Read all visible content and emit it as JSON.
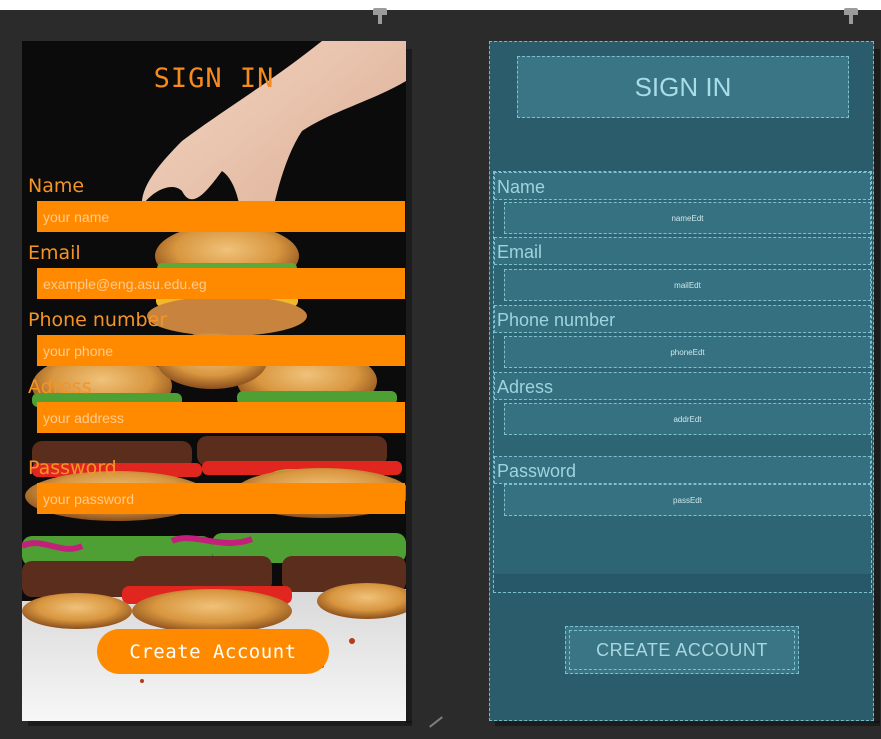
{
  "design": {
    "title": "SIGN IN",
    "fields": [
      {
        "label": "Name",
        "placeholder": "your name"
      },
      {
        "label": "Email",
        "placeholder": "example@eng.asu.edu.eg"
      },
      {
        "label": "Phone number",
        "placeholder": "your phone"
      },
      {
        "label": "Adress",
        "placeholder": "your address"
      },
      {
        "label": "Password",
        "placeholder": "your password"
      }
    ],
    "button_label": "Create Account"
  },
  "blueprint": {
    "title": "SIGN IN",
    "labels": [
      "Name",
      "Email",
      "Phone number",
      "Adress",
      "Password"
    ],
    "field_ids": [
      "nameEdt",
      "mailEdt",
      "phoneEdt",
      "addrEdt",
      "passEdt"
    ],
    "button_label": "CREATE ACCOUNT"
  },
  "colors": {
    "accent_orange": "#ff8a00",
    "blueprint_bg": "#2a5c6b"
  },
  "icons": [
    "pin-icon",
    "resize-handle-icon"
  ]
}
